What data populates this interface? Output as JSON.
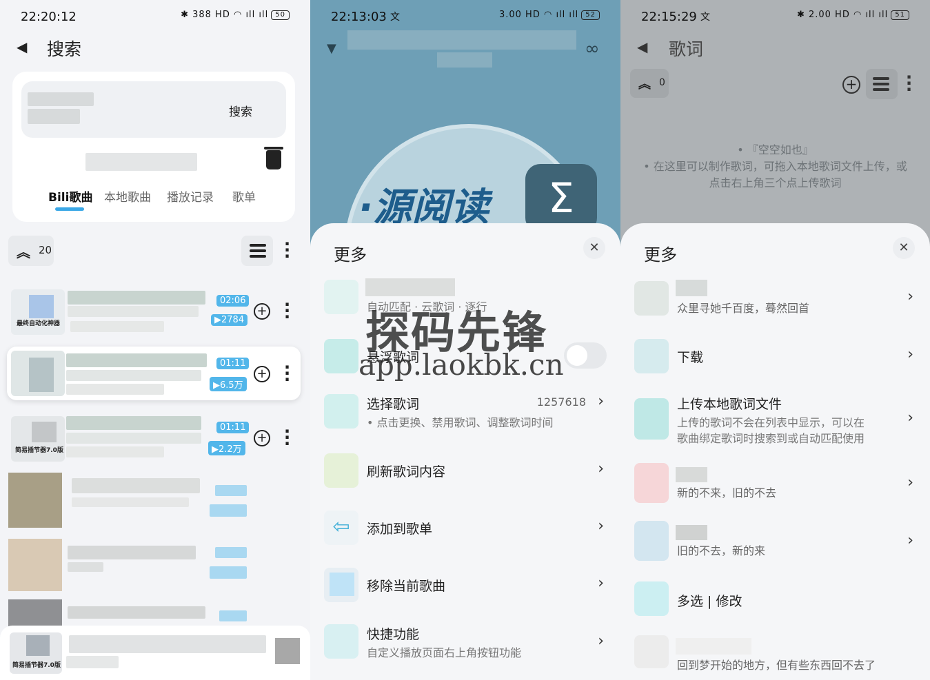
{
  "panel1": {
    "status": {
      "time": "22:20:12",
      "speed": "388",
      "battery": "50"
    },
    "back_icon": "back-arrow-icon",
    "title": "搜索",
    "search_button": "搜索",
    "tabs": [
      "Bili歌曲",
      "本地歌曲",
      "播放记录",
      "歌单"
    ],
    "active_tab": 0,
    "count": "20",
    "songs": [
      {
        "duration": "02:06",
        "plays": "2784",
        "thumb_text": "最终自动化神器"
      },
      {
        "duration": "01:11",
        "plays": "6.5万",
        "thumb_text": ""
      },
      {
        "duration": "01:11",
        "plays": "2.2万",
        "thumb_text": "简易插节器7.0版"
      }
    ],
    "last_thumb_text": "简易插节器7.0版"
  },
  "panel2": {
    "status": {
      "time": "22:13:03",
      "speed": "3.00",
      "battery": "52"
    },
    "cover_text": "·源阅读",
    "sheet_title": "更多",
    "rows": [
      {
        "title": "",
        "sub": "自动匹配 · 云歌词 · 逐行"
      },
      {
        "title": "悬浮歌词",
        "sub": ""
      },
      {
        "title": "选择歌词",
        "value": "1257618",
        "sub": "• 点击更换、禁用歌词、调整歌词时间"
      },
      {
        "title": "刷新歌词内容",
        "sub": ""
      },
      {
        "title": "添加到歌单",
        "sub": ""
      },
      {
        "title": "移除当前歌曲",
        "sub": ""
      },
      {
        "title": "快捷功能",
        "sub": "自定义播放页面右上角按钮功能"
      }
    ]
  },
  "panel3": {
    "status": {
      "time": "22:15:29",
      "speed": "2.00",
      "battery": "51"
    },
    "title": "歌词",
    "count": "0",
    "lyric_lines": [
      "• 『空空如也』",
      "• 在这里可以制作歌词，可拖入本地歌词文件上传，或",
      "点击右上角三个点上传歌词"
    ],
    "sheet_title": "更多",
    "rows": [
      {
        "title": "",
        "sub": "众里寻她千百度，蓦然回首"
      },
      {
        "title": "下载",
        "sub": ""
      },
      {
        "title": "上传本地歌词文件",
        "sub": "上传的歌词不会在列表中显示，可以在",
        "sub2": "歌曲绑定歌词时搜索到或自动匹配使用"
      },
      {
        "title": "",
        "sub": "新的不来，旧的不去"
      },
      {
        "title": "",
        "sub": "旧的不去，新的来"
      },
      {
        "title": "多选 | 修改",
        "sub": ""
      },
      {
        "title": "",
        "sub": "回到梦开始的地方，但有些东西回不去了"
      }
    ]
  },
  "watermark": {
    "line1": "探码先锋",
    "line2": "app.laokbk.cn"
  }
}
